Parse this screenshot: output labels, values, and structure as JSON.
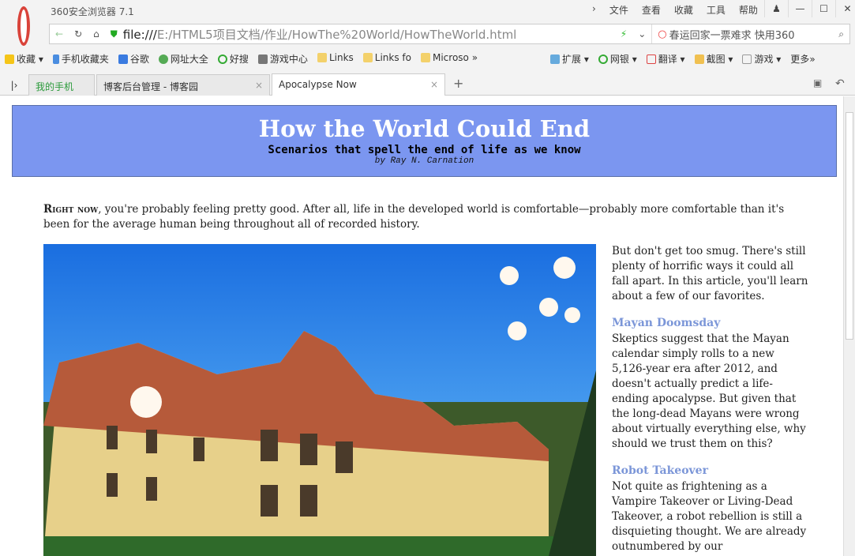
{
  "browser": {
    "title": "360安全浏览器 7.1",
    "menu": [
      "文件",
      "查看",
      "收藏",
      "工具",
      "帮助"
    ],
    "url_scheme": "file:///",
    "url_path": "E:/HTML5项目文档/作业/HowThe%20World/HowTheWorld.html",
    "search_placeholder": "春运回家一票难求 快用360",
    "bookmarks": [
      "收藏",
      "手机收藏夹",
      "谷歌",
      "网址大全",
      "好搜",
      "游戏中心",
      "Links",
      "Links fo",
      "Microso"
    ],
    "tools": [
      "扩展",
      "网银",
      "翻译",
      "截图",
      "游戏",
      "更多"
    ],
    "tabs": [
      {
        "label": "我的手机"
      },
      {
        "label": "博客后台管理 - 博客园"
      },
      {
        "label": "Apocalypse Now"
      }
    ]
  },
  "page": {
    "title": "How the World Could End",
    "subtitle": "Scenarios that spell the end of life as we know",
    "byline": "by Ray N. Carnation",
    "intro_lead": "Right now",
    "intro_rest": ", you're probably feeling pretty good. After all, life in the developed world is comfortable—probably more comfortable than it's been for the average human being throughout all of recorded history.",
    "side_intro": "But don't get too smug. There's still plenty of horrific ways it could all fall apart. In this article, you'll learn about a few of our favorites.",
    "sections": [
      {
        "heading": "Mayan Doomsday",
        "text": "Skeptics suggest that the Mayan calendar simply rolls to a new 5,126-year era after 2012, and doesn't actually predict a life-ending apocalypse. But given that the long-dead Mayans were wrong about virtually everything else, why should we trust them on this?"
      },
      {
        "heading": "Robot Takeover",
        "text": "Not quite as frightening as a Vampire Takeover or Living-Dead Takeover, a robot rebellion is still a disquieting thought. We are already outnumbered by our"
      }
    ]
  },
  "colors": {
    "header_bg": "#7b96f0",
    "heading_link": "#7b96d8"
  }
}
